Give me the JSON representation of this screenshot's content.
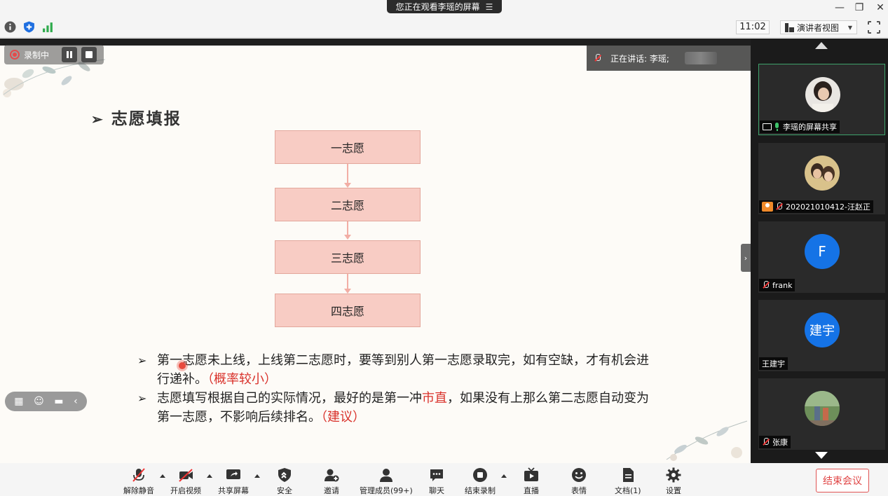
{
  "titlebar": {
    "share_notice": "您正在观看李瑶的屏幕",
    "icons": [
      "menu-icon",
      "minimize-icon",
      "restore-icon",
      "close-icon"
    ]
  },
  "toolbar": {
    "time": "11:02",
    "view_mode": "演讲者视图",
    "icons": [
      "info-icon",
      "shield-icon",
      "signal-icon",
      "layout-icon",
      "fullscreen-icon"
    ]
  },
  "recording": {
    "label": "录制中"
  },
  "speaking": {
    "label": "正在讲话: 李瑶;"
  },
  "slide": {
    "title": "志愿填报",
    "flow": [
      "一志愿",
      "二志愿",
      "三志愿",
      "四志愿"
    ],
    "bullet1": {
      "text": "第一志愿未上线，上线第二志愿时，要等到别人第一志愿录取完，如有空缺，才有机会进行递补。",
      "note": "（概率较小）"
    },
    "bullet2": {
      "text_a": "志愿填写根据自己的实际情况，最好的是第一冲",
      "highlight": "市直",
      "text_b": "，如果没有上那么第二志愿自动变为第一志愿，不影响后续排名。",
      "note": "（建议）"
    }
  },
  "participants": [
    {
      "label": "李瑶的屏幕共享",
      "avatar": "photo"
    },
    {
      "label": "202021010412-汪赵正",
      "avatar": "photo"
    },
    {
      "label": "frank",
      "avatar": "F"
    },
    {
      "label": "王建宇",
      "avatar": "建宇"
    },
    {
      "label": "张康",
      "avatar": "photo"
    }
  ],
  "bottom": {
    "unmute": "解除静音",
    "video": "开启视频",
    "share": "共享屏幕",
    "security": "安全",
    "invite": "邀请",
    "members": "管理成员(99+)",
    "chat": "聊天",
    "end_record": "结束录制",
    "live": "直播",
    "emoji": "表情",
    "docs": "文档(1)",
    "settings": "设置",
    "end_meeting": "结束会议"
  },
  "colors": {
    "accent_red": "#d9322b",
    "box_fill": "#f8ccc4",
    "avatar_blue": "#1573e6",
    "active_green": "#3ea26b"
  }
}
